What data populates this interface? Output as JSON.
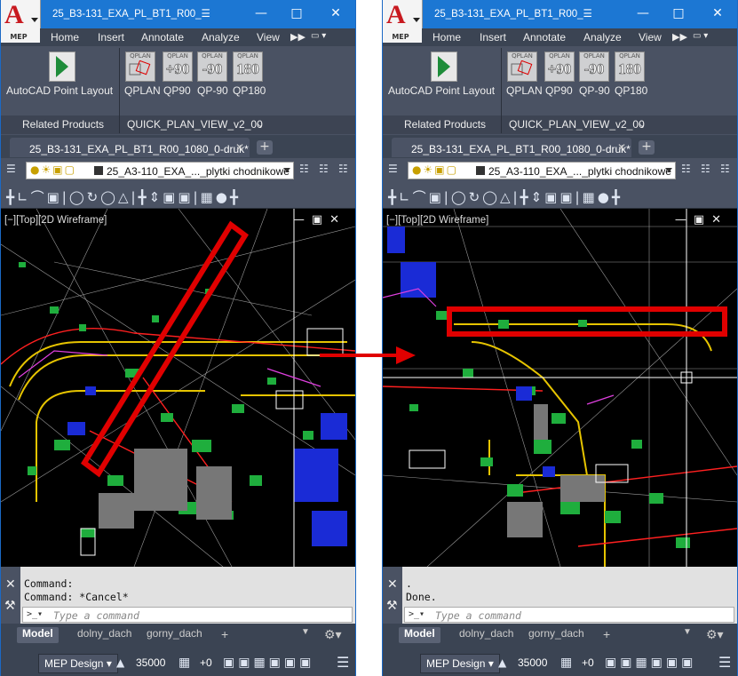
{
  "panels": [
    {
      "title": "25_B3-131_EXA_PL_BT1_R00_☰",
      "menu": [
        "Home",
        "Insert",
        "Annotate",
        "Analyze",
        "View"
      ],
      "ribbon": {
        "group1_button": "AutoCAD Point Layout",
        "group1_label": "Related Products",
        "qp_tiles": [
          {
            "small": "QPLAN",
            "big": "",
            "label": "QPLAN"
          },
          {
            "small": "QPLAN",
            "big": "+90",
            "label": "QP90"
          },
          {
            "small": "QPLAN",
            "big": "-90",
            "label": "QP-90"
          },
          {
            "small": "QPLAN",
            "big": "180",
            "label": "QP180"
          }
        ],
        "group2_label": "QUICK_PLAN_VIEW_v2_00"
      },
      "doc_tab": "25_B3-131_EXA_PL_BT1_R00_1080_0-druk*",
      "layer": "25_A3-110_EXA_..._plytki chodnikowe",
      "viewport_label": "[−][Top][2D Wireframe]",
      "cmd_lines": [
        "Command:",
        "Command: *Cancel*"
      ],
      "cmd_placeholder": "Type a command",
      "layout_tabs": [
        "Model",
        "dolny_dach",
        "gorny_dach"
      ],
      "status": {
        "workspace": "MEP Design",
        "scale": "35000",
        "offset": "+0"
      }
    },
    {
      "title": "25_B3-131_EXA_PL_BT1_R00_☰",
      "menu": [
        "Home",
        "Insert",
        "Annotate",
        "Analyze",
        "View"
      ],
      "ribbon": {
        "group1_button": "AutoCAD Point Layout",
        "group1_label": "Related Products",
        "qp_tiles": [
          {
            "small": "QPLAN",
            "big": "",
            "label": "QPLAN"
          },
          {
            "small": "QPLAN",
            "big": "+90",
            "label": "QP90"
          },
          {
            "small": "QPLAN",
            "big": "-90",
            "label": "QP-90"
          },
          {
            "small": "QPLAN",
            "big": "180",
            "label": "QP180"
          }
        ],
        "group2_label": "QUICK_PLAN_VIEW_v2_00"
      },
      "doc_tab": "25_B3-131_EXA_PL_BT1_R00_1080_0-druk*",
      "layer": "25_A3-110_EXA_..._plytki chodnikowe",
      "viewport_label": "[−][Top][2D Wireframe]",
      "cmd_lines": [
        ".",
        "Done."
      ],
      "cmd_placeholder": "Type a command",
      "layout_tabs": [
        "Model",
        "dolny_dach",
        "gorny_dach"
      ],
      "status": {
        "workspace": "MEP Design",
        "scale": "35000",
        "offset": "+0"
      }
    }
  ],
  "logo": {
    "letter": "A",
    "product": "MEP"
  },
  "colors": {
    "titlebar": "#1c77d3",
    "ribbon": "#4a5263",
    "highlight": "#e00000",
    "viewport": "#000000"
  }
}
